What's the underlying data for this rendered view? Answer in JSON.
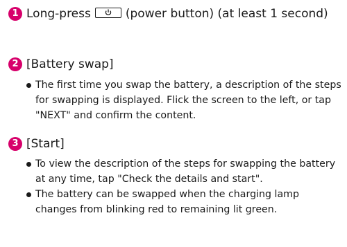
{
  "steps": [
    {
      "number": "1",
      "text_before": "Long-press",
      "key_icon": "power-key-icon",
      "text_after": "(power button) (at least 1 second)"
    },
    {
      "number": "2",
      "text": "[Battery swap]",
      "bullets": [
        "The first time you swap the battery, a description of the steps for swapping is displayed. Flick the screen to the left, or tap \"NEXT\" and confirm the content."
      ]
    },
    {
      "number": "3",
      "text": "[Start]",
      "bullets": [
        "To view the description of the steps for swapping the battery at any time, tap \"Check the details and start\".",
        "The battery can be swapped when the charging lamp changes from blinking red to remaining lit green."
      ]
    }
  ],
  "colors": {
    "step_badge": "#d7006b",
    "text": "#1a1a1a"
  }
}
